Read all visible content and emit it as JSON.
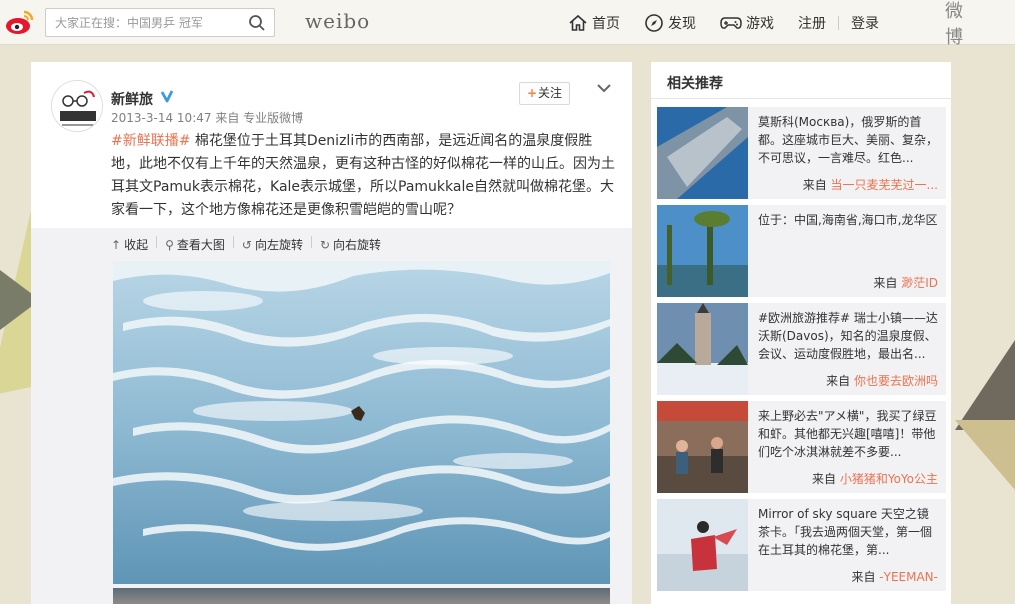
{
  "header": {
    "search_placeholder": "大家正在搜：中国男乒 冠军",
    "brand": "weibo",
    "nav": [
      {
        "label": "首页",
        "icon": "home-icon"
      },
      {
        "label": "发现",
        "icon": "compass-icon"
      },
      {
        "label": "游戏",
        "icon": "gamepad-icon"
      }
    ],
    "register": "注册",
    "login": "登录",
    "weibo_cn": "微博"
  },
  "post": {
    "author": "新鲜旅",
    "meta": "2013-3-14 10:47 来自 专业版微博",
    "follow_label": "关注",
    "hashtag": "#新鲜联播#",
    "body": " 棉花堡位于土耳其Denizli市的西南部，是远近闻名的温泉度假胜地，此地不仅有上千年的天然温泉，更有这种古怪的好似棉花一样的山丘。因为土耳其文Pamuk表示棉花，Kale表示城堡，所以Pamukkale自然就叫做棉花堡。大家看一下，这个地方像棉花还是更像积雪皑皑的雪山呢？",
    "tools": [
      "收起",
      "查看大图",
      "向左旋转",
      "向右旋转"
    ]
  },
  "side": {
    "title": "相关推荐",
    "from_prefix": "来自",
    "items": [
      {
        "desc": "莫斯科(Москва)，俄罗斯的首都。这座城市巨大、美丽、复杂，不可思议，一言难尽。红色...",
        "source": "当一只麦芜芜过一..."
      },
      {
        "desc": "位于：中国,海南省,海口市,龙华区",
        "source": "渺茫ID"
      },
      {
        "desc": "#欧洲旅游推荐# 瑞士小镇——达沃斯(Davos)，知名的温泉度假、会议、运动度假胜地，最出名...",
        "source": "你也要去欧洲吗"
      },
      {
        "desc": "来上野必去\"アメ横\"，我买了绿豆和虾。其他都无兴趣[嘻嘻]！带他们吃个冰淇淋就差不多要...",
        "source": "小猪猪和YoYo公主"
      },
      {
        "desc": "Mirror of sky square 天空之镜 茶卡。「我去過两個天堂，第一個在土耳其的棉花堡，第...",
        "source": "-YEEMAN-"
      }
    ]
  },
  "colors": {
    "accent": "#eb7350",
    "follow_plus": "#ff8140",
    "verified": "#3b9ae6"
  }
}
